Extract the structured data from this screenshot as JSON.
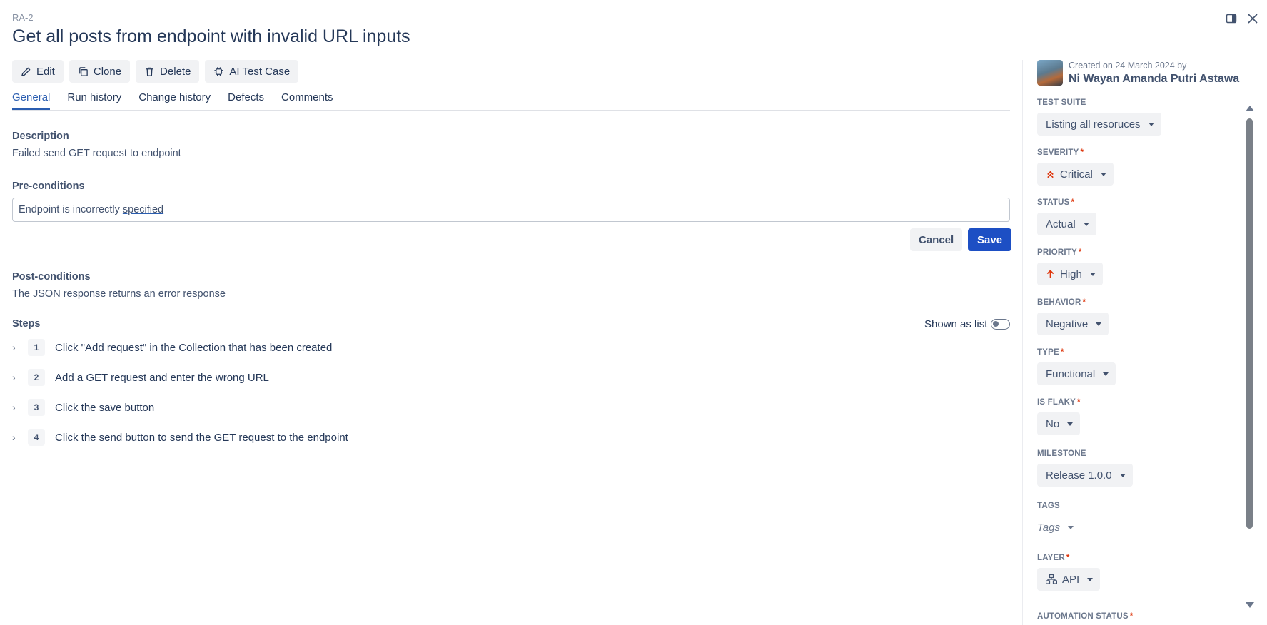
{
  "header": {
    "case_id": "RA-2",
    "title": "Get all posts from endpoint with invalid URL inputs"
  },
  "window_icons": [
    "panel-toggle-icon",
    "close-icon"
  ],
  "toolbar": {
    "edit": "Edit",
    "clone": "Clone",
    "delete": "Delete",
    "ai_test_case": "AI Test Case"
  },
  "tabs": [
    {
      "label": "General",
      "active": true
    },
    {
      "label": "Run history",
      "active": false
    },
    {
      "label": "Change history",
      "active": false
    },
    {
      "label": "Defects",
      "active": false
    },
    {
      "label": "Comments",
      "active": false
    }
  ],
  "description": {
    "label": "Description",
    "text": "Failed send GET request to endpoint"
  },
  "preconditions": {
    "label": "Pre-conditions",
    "value_prefix": "Endpoint is incorrectly ",
    "value_underlined": "specified",
    "cancel_label": "Cancel",
    "save_label": "Save"
  },
  "postconditions": {
    "label": "Post-conditions",
    "text": "The JSON response returns an error response"
  },
  "steps": {
    "label": "Steps",
    "shown_as_list_label": "Shown as list",
    "shown_as_list": false,
    "items": [
      {
        "num": "1",
        "text": "Click \"Add request\" in the Collection that has been created"
      },
      {
        "num": "2",
        "text": "Add a GET request and enter the wrong URL"
      },
      {
        "num": "3",
        "text": "Click the save button"
      },
      {
        "num": "4",
        "text": "Click the send button to send the GET request to the endpoint"
      }
    ]
  },
  "sidebar": {
    "created_text": "Created on 24 March 2024 by",
    "author": "Ni Wayan Amanda Putri Astawa",
    "fields": {
      "test_suite": {
        "label": "TEST SUITE",
        "value": "Listing all resoruces"
      },
      "severity": {
        "label": "SEVERITY",
        "required": "*",
        "value": "Critical",
        "icon": "double-chevron-up-icon",
        "color": "#de350b"
      },
      "status": {
        "label": "STATUS",
        "required": "*",
        "value": "Actual"
      },
      "priority": {
        "label": "PRIORITY",
        "required": "*",
        "value": "High",
        "icon": "arrow-up-icon",
        "color": "#de350b"
      },
      "behavior": {
        "label": "BEHAVIOR",
        "required": "*",
        "value": "Negative"
      },
      "type": {
        "label": "TYPE",
        "required": "*",
        "value": "Functional"
      },
      "is_flaky": {
        "label": "IS FLAKY",
        "required": "*",
        "value": "No"
      },
      "milestone": {
        "label": "MILESTONE",
        "value": "Release 1.0.0"
      },
      "tags": {
        "label": "TAGS",
        "placeholder": "Tags"
      },
      "layer": {
        "label": "LAYER",
        "required": "*",
        "value": "API",
        "icon": "hierarchy-icon"
      },
      "automation_status": {
        "label": "AUTOMATION STATUS",
        "required": "*"
      }
    }
  },
  "colors": {
    "accent": "#2a5db0",
    "primary_button": "#1d4fc4",
    "required_mark": "#de350b"
  }
}
